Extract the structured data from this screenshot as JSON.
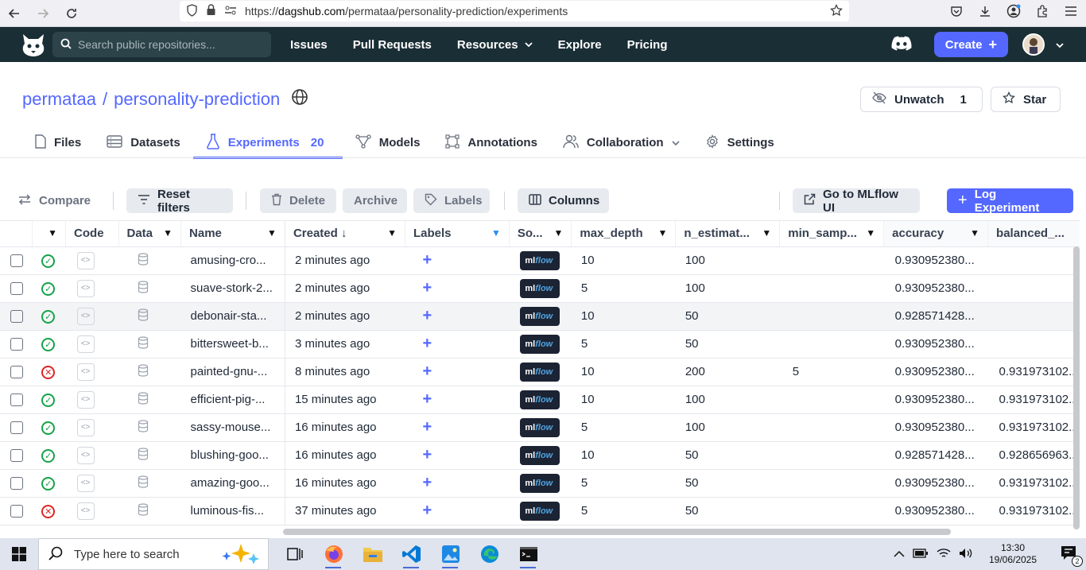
{
  "browser": {
    "url_prefix": "https://",
    "url_host": "dagshub.com",
    "url_path": "/permataa/personality-prediction/experiments"
  },
  "header": {
    "search_placeholder": "Search public repositories...",
    "nav": [
      "Issues",
      "Pull Requests",
      "Resources",
      "Explore",
      "Pricing"
    ],
    "create_label": "Create"
  },
  "repo": {
    "owner": "permataa",
    "separator": "/",
    "name": "personality-prediction",
    "unwatch_label": "Unwatch",
    "unwatch_count": "1",
    "star_label": "Star"
  },
  "tabs": [
    {
      "label": "Files"
    },
    {
      "label": "Datasets"
    },
    {
      "label": "Experiments",
      "badge": "20"
    },
    {
      "label": "Models"
    },
    {
      "label": "Annotations"
    },
    {
      "label": "Collaboration"
    },
    {
      "label": "Settings"
    }
  ],
  "toolbar": {
    "compare": "Compare",
    "reset_filters": "Reset filters",
    "delete": "Delete",
    "archive": "Archive",
    "labels": "Labels",
    "columns": "Columns",
    "mlflow_ui": "Go to MLflow UI",
    "log_experiment": "Log Experiment"
  },
  "table": {
    "columns": [
      "Code",
      "Data",
      "Name",
      "Created",
      "Labels",
      "So...",
      "max_depth",
      "n_estimat...",
      "min_samp...",
      "accuracy",
      "balanced_..."
    ],
    "source_label": "ml",
    "source_label_2": "flow",
    "rows": [
      {
        "status": "ok",
        "name": "amusing-cro...",
        "created": "2 minutes ago",
        "max_depth": "10",
        "n_est": "100",
        "min_samp": "",
        "accuracy": "0.930952380...",
        "balanced": ""
      },
      {
        "status": "ok",
        "name": "suave-stork-2...",
        "created": "2 minutes ago",
        "max_depth": "5",
        "n_est": "100",
        "min_samp": "",
        "accuracy": "0.930952380...",
        "balanced": ""
      },
      {
        "status": "ok",
        "name": "debonair-sta...",
        "created": "2 minutes ago",
        "max_depth": "10",
        "n_est": "50",
        "min_samp": "",
        "accuracy": "0.928571428...",
        "balanced": ""
      },
      {
        "status": "ok",
        "name": "bittersweet-b...",
        "created": "3 minutes ago",
        "max_depth": "5",
        "n_est": "50",
        "min_samp": "",
        "accuracy": "0.930952380...",
        "balanced": ""
      },
      {
        "status": "err",
        "name": "painted-gnu-...",
        "created": "8 minutes ago",
        "max_depth": "10",
        "n_est": "200",
        "min_samp": "5",
        "accuracy": "0.930952380...",
        "balanced": "0.931973102..."
      },
      {
        "status": "ok",
        "name": "efficient-pig-...",
        "created": "15 minutes ago",
        "max_depth": "10",
        "n_est": "100",
        "min_samp": "",
        "accuracy": "0.930952380...",
        "balanced": "0.931973102..."
      },
      {
        "status": "ok",
        "name": "sassy-mouse...",
        "created": "16 minutes ago",
        "max_depth": "5",
        "n_est": "100",
        "min_samp": "",
        "accuracy": "0.930952380...",
        "balanced": "0.931973102..."
      },
      {
        "status": "ok",
        "name": "blushing-goo...",
        "created": "16 minutes ago",
        "max_depth": "10",
        "n_est": "50",
        "min_samp": "",
        "accuracy": "0.928571428...",
        "balanced": "0.928656963..."
      },
      {
        "status": "ok",
        "name": "amazing-goo...",
        "created": "16 minutes ago",
        "max_depth": "5",
        "n_est": "50",
        "min_samp": "",
        "accuracy": "0.930952380...",
        "balanced": "0.931973102..."
      },
      {
        "status": "err",
        "name": "luminous-fis...",
        "created": "37 minutes ago",
        "max_depth": "5",
        "n_est": "50",
        "min_samp": "",
        "accuracy": "0.930952380...",
        "balanced": "0.931973102..."
      }
    ]
  },
  "taskbar": {
    "search_placeholder": "Type here to search",
    "time": "13:30",
    "date": "19/06/2025",
    "notifications": "2"
  },
  "colors": {
    "accent": "#5468ff",
    "header_bg": "#1a2e35",
    "success": "#16a34a",
    "error": "#dc2626"
  }
}
